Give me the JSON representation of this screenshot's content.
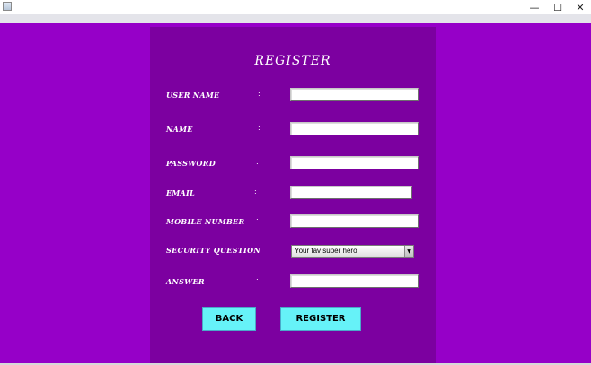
{
  "window": {
    "controls": {
      "minimize": "—",
      "maximize": "☐",
      "close": "✕"
    },
    "icon": "java-app-icon"
  },
  "form": {
    "title": "REGISTER",
    "colon": ":",
    "fields": [
      {
        "label": "USER NAME",
        "value": ""
      },
      {
        "label": "NAME",
        "value": ""
      },
      {
        "label": "PASSWORD",
        "value": ""
      },
      {
        "label": "EMAIL",
        "value": ""
      },
      {
        "label": "MOBILE NUMBER",
        "value": ""
      },
      {
        "label": "SECURITY QUESTION",
        "selected": "Your fav super hero"
      },
      {
        "label": "ANSWER",
        "value": ""
      }
    ],
    "buttons": {
      "back": "BACK",
      "register": "REGISTER"
    }
  },
  "colors": {
    "background": "#9600c8",
    "panel": "#7c00a0",
    "button": "#66f2f8",
    "text": "#ffffff"
  }
}
